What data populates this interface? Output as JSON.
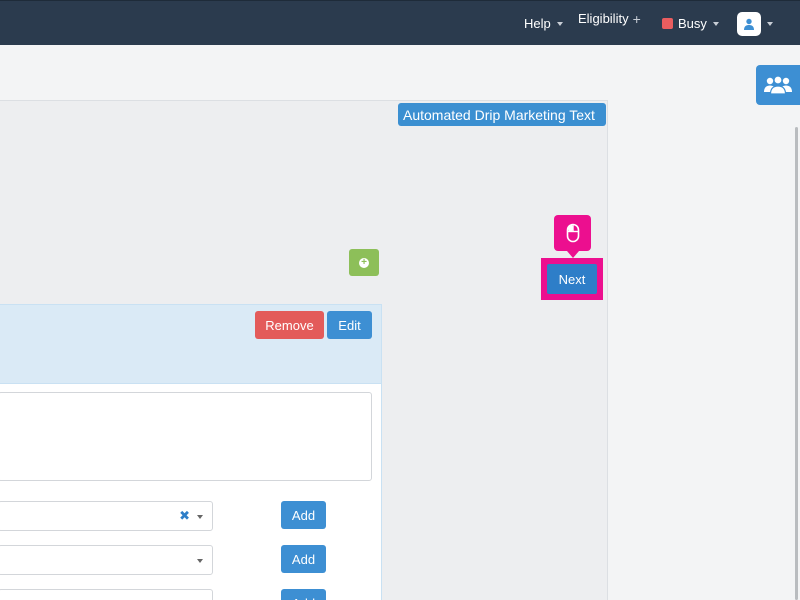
{
  "topbar": {
    "help_label": "Help",
    "eligibility_label": "Eligibility",
    "status_label": "Busy",
    "status_color": "#e95d5f",
    "icons": {
      "user": "user-avatar-icon",
      "team": "team-users-icon",
      "mouse": "mouse-click-icon",
      "add": "plus-circle-icon"
    }
  },
  "panel": {
    "tag_label": "Automated Drip Marketing Text"
  },
  "card": {
    "remove_label": "Remove",
    "edit_label": "Edit",
    "rows": [
      {
        "add_label": "Add",
        "clear_glyph": "✖"
      },
      {
        "add_label": "Add"
      },
      {
        "add_label": "Add"
      }
    ]
  },
  "actions": {
    "next_label": "Next"
  },
  "colors": {
    "topbar": "#2b3b4e",
    "primary": "#3d8fd3",
    "danger": "#e35b5a",
    "success": "#8dbf59",
    "highlight": "#ec0f8f"
  }
}
